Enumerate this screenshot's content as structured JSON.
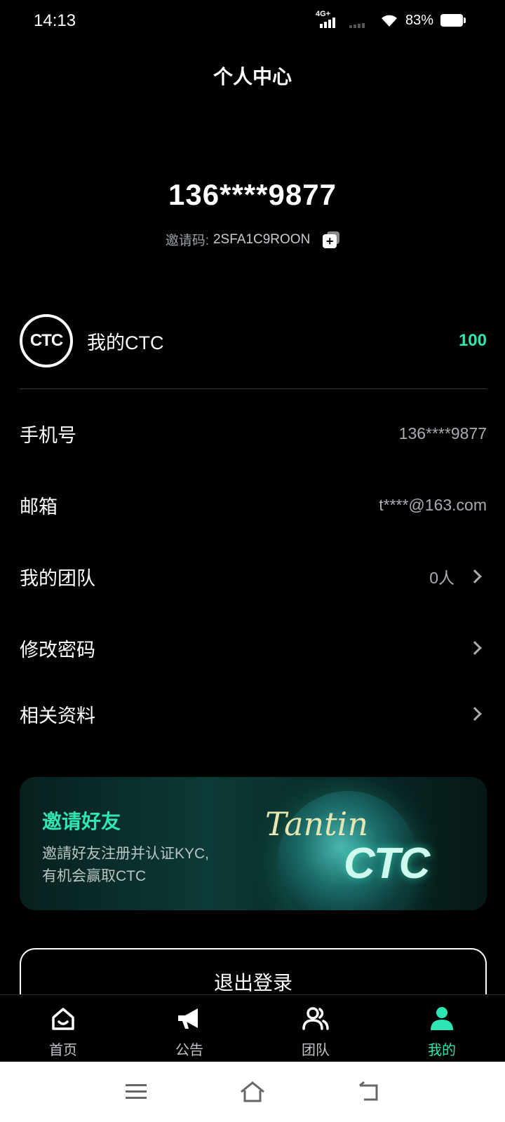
{
  "status": {
    "time": "14:13",
    "network": "4G+",
    "battery": "83%"
  },
  "header": {
    "title": "个人中心"
  },
  "profile": {
    "phone": "136****9877",
    "invite_label": "邀请码:",
    "invite_code": "2SFA1C9ROON"
  },
  "ctc": {
    "logo_text": "CTC",
    "label": "我的CTC",
    "value": "100"
  },
  "rows": {
    "phone_label": "手机号",
    "phone_value": "136****9877",
    "email_label": "邮箱",
    "email_value": "t****@163.com",
    "team_label": "我的团队",
    "team_value": "0人",
    "password_label": "修改密码",
    "docs_label": "相关资料"
  },
  "banner": {
    "title": "邀请好友",
    "desc_line1": "邀請好友注册并认证KYC,",
    "desc_line2": "有机会赢取CTC",
    "art_text1": "Tantin",
    "art_text2": "CTC"
  },
  "logout": {
    "label": "退出登录"
  },
  "nav": {
    "items": [
      {
        "label": "首页",
        "icon": "home-icon"
      },
      {
        "label": "公告",
        "icon": "megaphone-icon"
      },
      {
        "label": "团队",
        "icon": "team-icon"
      },
      {
        "label": "我的",
        "icon": "user-icon"
      }
    ],
    "active": "我的"
  },
  "colors": {
    "accent": "#2ee5b4",
    "background": "#000000"
  }
}
